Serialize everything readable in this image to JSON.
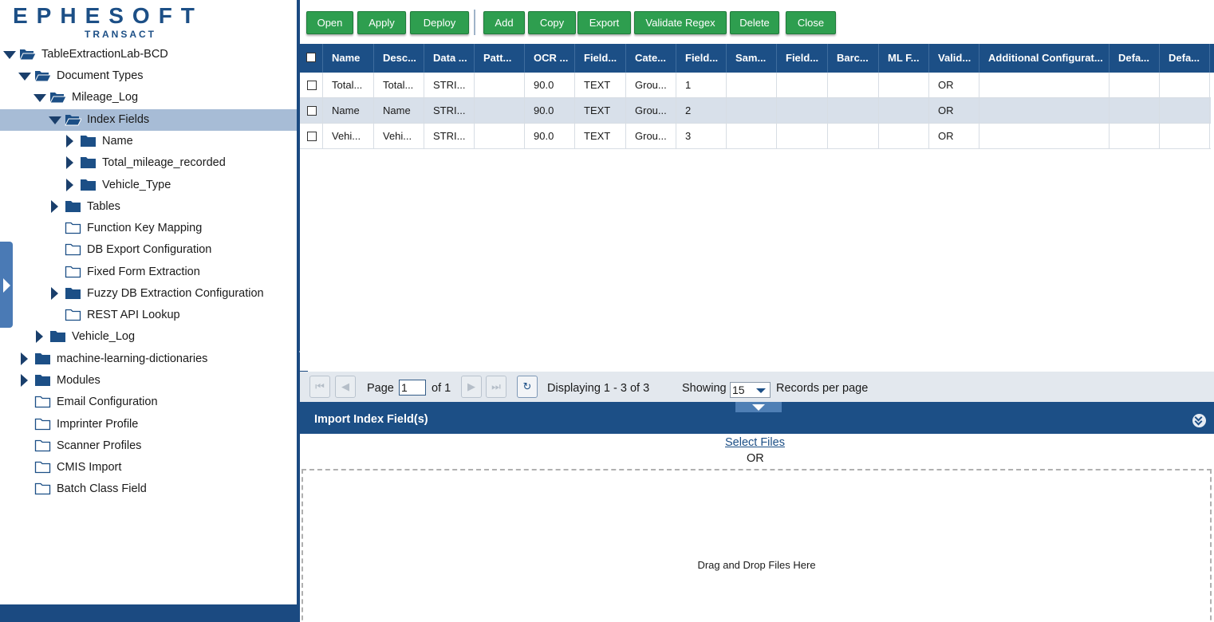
{
  "logo": {
    "brand": "EPHESOFT",
    "sub": "TRANSACT"
  },
  "tree": [
    {
      "label": "TableExtractionLab-BCD",
      "depth": 0,
      "toggle": "open",
      "folder": "open",
      "selected": false
    },
    {
      "label": "Document Types",
      "depth": 1,
      "toggle": "open",
      "folder": "open",
      "selected": false
    },
    {
      "label": "Mileage_Log",
      "depth": 2,
      "toggle": "open",
      "folder": "open",
      "selected": false
    },
    {
      "label": "Index Fields",
      "depth": 3,
      "toggle": "open",
      "folder": "open",
      "selected": true
    },
    {
      "label": "Name",
      "depth": 4,
      "toggle": "closed",
      "folder": "closed",
      "selected": false
    },
    {
      "label": "Total_mileage_recorded",
      "depth": 4,
      "toggle": "closed",
      "folder": "closed",
      "selected": false
    },
    {
      "label": "Vehicle_Type",
      "depth": 4,
      "toggle": "closed",
      "folder": "closed",
      "selected": false
    },
    {
      "label": "Tables",
      "depth": 3,
      "toggle": "closed",
      "folder": "closed",
      "selected": false
    },
    {
      "label": "Function Key Mapping",
      "depth": 3,
      "toggle": "none",
      "folder": "empty",
      "selected": false
    },
    {
      "label": "DB Export Configuration",
      "depth": 3,
      "toggle": "none",
      "folder": "empty",
      "selected": false
    },
    {
      "label": "Fixed Form Extraction",
      "depth": 3,
      "toggle": "none",
      "folder": "empty",
      "selected": false
    },
    {
      "label": "Fuzzy DB Extraction Configuration",
      "depth": 3,
      "toggle": "closed",
      "folder": "closed",
      "selected": false
    },
    {
      "label": "REST API Lookup",
      "depth": 3,
      "toggle": "none",
      "folder": "empty",
      "selected": false
    },
    {
      "label": "Vehicle_Log",
      "depth": 2,
      "toggle": "closed",
      "folder": "closed",
      "selected": false
    },
    {
      "label": "machine-learning-dictionaries",
      "depth": 1,
      "toggle": "closed",
      "folder": "closed",
      "selected": false
    },
    {
      "label": "Modules",
      "depth": 1,
      "toggle": "closed",
      "folder": "closed",
      "selected": false
    },
    {
      "label": "Email Configuration",
      "depth": 1,
      "toggle": "none",
      "folder": "empty",
      "selected": false
    },
    {
      "label": "Imprinter Profile",
      "depth": 1,
      "toggle": "none",
      "folder": "empty",
      "selected": false
    },
    {
      "label": "Scanner Profiles",
      "depth": 1,
      "toggle": "none",
      "folder": "empty",
      "selected": false
    },
    {
      "label": "CMIS Import",
      "depth": 1,
      "toggle": "none",
      "folder": "empty",
      "selected": false
    },
    {
      "label": "Batch Class Field",
      "depth": 1,
      "toggle": "none",
      "folder": "empty",
      "selected": false
    }
  ],
  "toolbar": [
    {
      "label": "Open",
      "name": "open-button"
    },
    {
      "label": "Apply",
      "name": "apply-button"
    },
    {
      "label": "Deploy",
      "name": "deploy-button"
    },
    {
      "label": "Add",
      "name": "add-button"
    },
    {
      "label": "Copy",
      "name": "copy-button"
    },
    {
      "label": "Export",
      "name": "export-button"
    },
    {
      "label": "Validate Regex",
      "name": "validate-regex-button"
    },
    {
      "label": "Delete",
      "name": "delete-button"
    },
    {
      "label": "Close",
      "name": "close-button"
    }
  ],
  "grid": {
    "columns": [
      "Name",
      "Desc...",
      "Data ...",
      "Patt...",
      "OCR ...",
      "Field...",
      "Cate...",
      "Field...",
      "Sam...",
      "Field...",
      "Barc...",
      "ML F...",
      "Valid...",
      "Additional Configurat...",
      "Defa...",
      "Defa..."
    ],
    "rows": [
      [
        "Total...",
        "Total...",
        "STRI...",
        "",
        "90.0",
        "TEXT",
        "Grou...",
        "1",
        "",
        "",
        "",
        "",
        "OR",
        "",
        "",
        ""
      ],
      [
        "Name",
        "Name",
        "STRI...",
        "",
        "90.0",
        "TEXT",
        "Grou...",
        "2",
        "",
        "",
        "",
        "",
        "OR",
        "",
        "",
        ""
      ],
      [
        "Vehi...",
        "Vehi...",
        "STRI...",
        "",
        "90.0",
        "TEXT",
        "Grou...",
        "3",
        "",
        "",
        "",
        "",
        "OR",
        "",
        "",
        ""
      ]
    ]
  },
  "pager": {
    "page_label": "Page",
    "page_value": "1",
    "of_label": "of 1",
    "displaying": "Displaying 1 - 3 of 3",
    "showing_label": "Showing",
    "per_page": "15",
    "records_label": "Records per page"
  },
  "import": {
    "title": "Import Index Field(s)",
    "select_files": "Select Files",
    "or": "OR",
    "drop_text": "Drag and Drop Files Here"
  },
  "colors": {
    "brand_blue": "#1c4f86",
    "button_green": "#2e9e4f",
    "selected_row": "#a7bcd6",
    "alt_row": "#d8e0ea"
  }
}
